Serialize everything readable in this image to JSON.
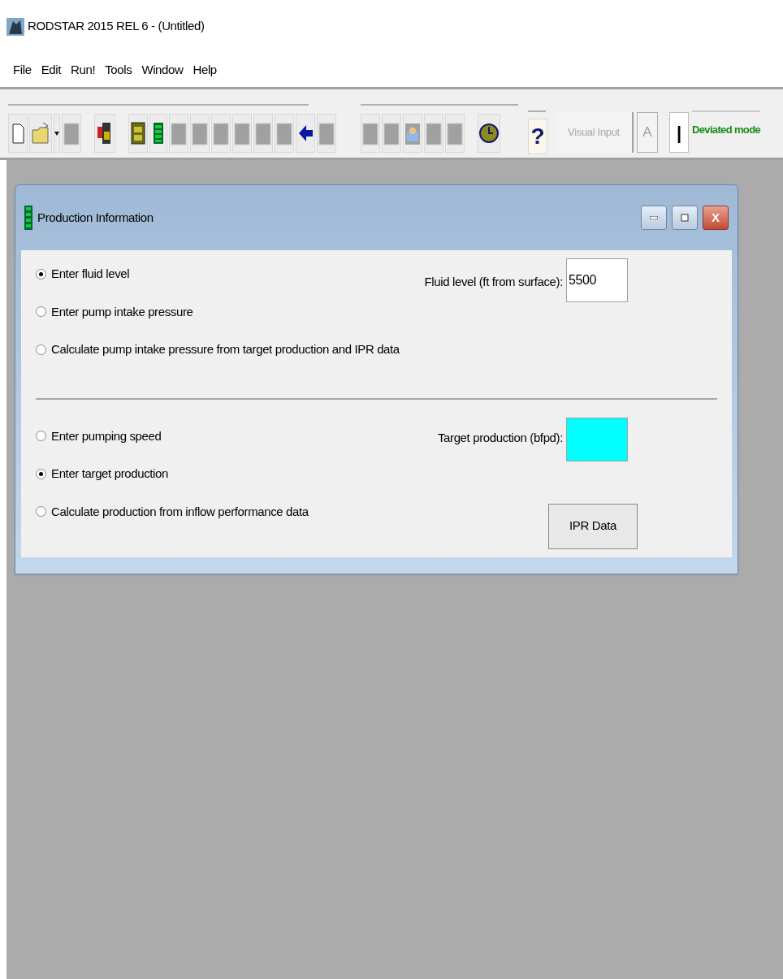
{
  "window": {
    "title": "RODSTAR 2015 REL 6 - (Untitled)"
  },
  "menu": [
    "File",
    "Edit",
    "Run!",
    "Tools",
    "Window",
    "Help"
  ],
  "toolbar": {
    "group_1": [
      {
        "kind": "new"
      },
      {
        "kind": "open"
      },
      {
        "kind": "dropdown"
      },
      {
        "kind": "disabled"
      },
      {
        "kind": "gap"
      },
      {
        "kind": "pump"
      },
      {
        "kind": "gap"
      },
      {
        "kind": "report"
      },
      {
        "kind": "data"
      },
      {
        "kind": "disabled"
      },
      {
        "kind": "disabled"
      },
      {
        "kind": "disabled"
      },
      {
        "kind": "disabled"
      },
      {
        "kind": "disabled"
      },
      {
        "kind": "disabled"
      },
      {
        "kind": "back"
      },
      {
        "kind": "disabled"
      }
    ],
    "group_2": [
      {
        "kind": "disabled"
      },
      {
        "kind": "disabled"
      },
      {
        "kind": "mail"
      },
      {
        "kind": "disabled"
      },
      {
        "kind": "disabled"
      },
      {
        "kind": "gap"
      },
      {
        "kind": "clock"
      }
    ],
    "help": "?",
    "visual_input": {
      "label": "Visual Input",
      "disabled": true
    },
    "font_button": "A",
    "cursor_button": "|",
    "mode": "Deviated mode"
  },
  "child_window": {
    "title": "Production Information",
    "close": "X",
    "fluid_options": [
      {
        "label": "Enter fluid level",
        "selected": true
      },
      {
        "label": "Enter pump intake pressure",
        "selected": false
      },
      {
        "label": "Calculate pump intake pressure from target production and IPR data",
        "selected": false
      }
    ],
    "fluid_field": {
      "label": "Fluid level (ft from surface):",
      "value": "5500"
    },
    "production_options": [
      {
        "label": "Enter pumping speed",
        "selected": false
      },
      {
        "label": "Enter target production",
        "selected": true
      },
      {
        "label": "Calculate production from inflow performance data",
        "selected": false
      }
    ],
    "target_field": {
      "label": "Target production (bfpd):"
    },
    "ipr_button": "IPR Data"
  }
}
